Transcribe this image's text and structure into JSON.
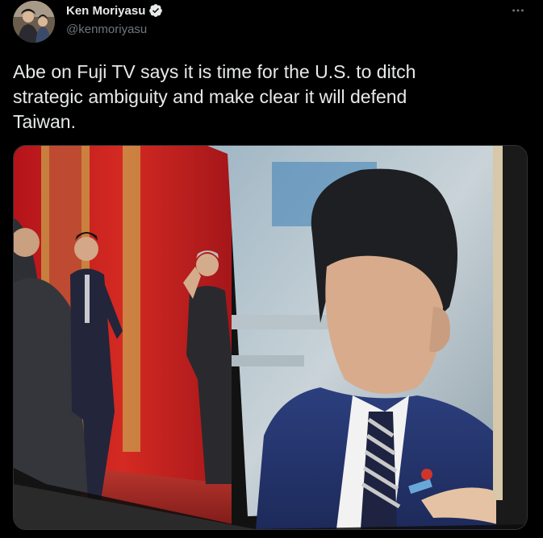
{
  "tweet": {
    "author": {
      "display_name": "Ken Moriyasu",
      "handle": "@kenmoriyasu",
      "verified": true,
      "verified_color": "#e7e9ea"
    },
    "text": "Abe on Fuji TV says it is time for the U.S. to ditch\nstrategic ambiguity and make clear it will defend\nTaiwan.",
    "more_icon": "more-horizontal-icon",
    "media": {
      "type": "photo",
      "icon": "photo-of-tv-screen"
    }
  },
  "colors": {
    "background": "#000000",
    "text_primary": "#e7e9ea",
    "text_secondary": "#71767b",
    "border": "#2f3336"
  }
}
